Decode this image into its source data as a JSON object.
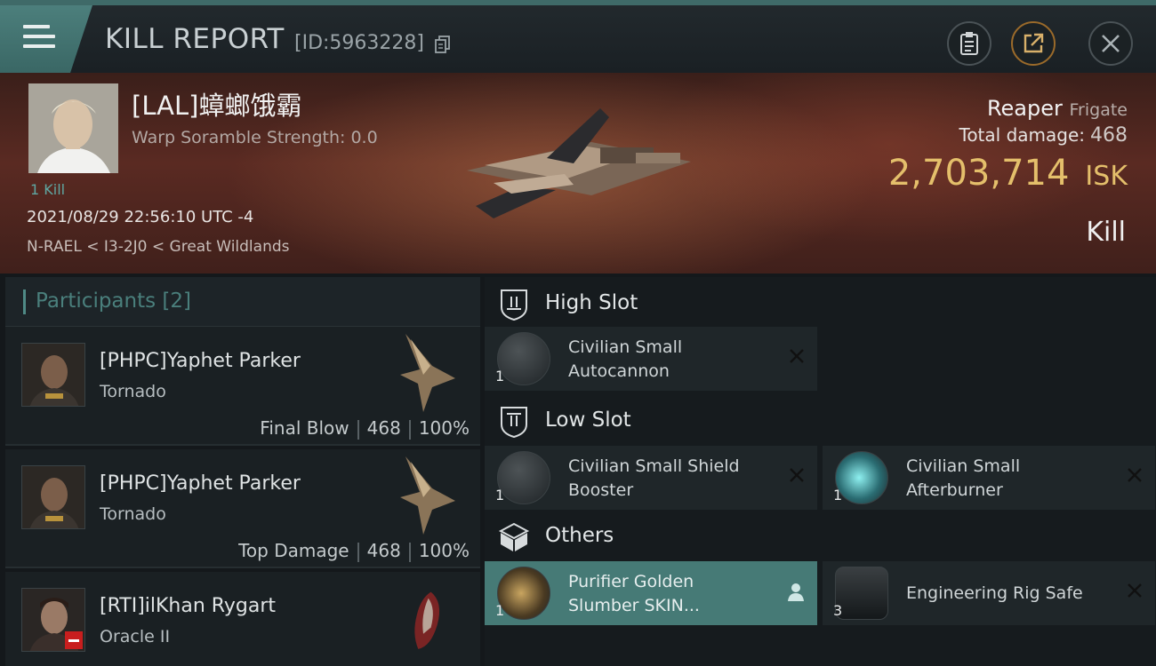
{
  "header": {
    "title": "KILL REPORT",
    "report_id": "[ID:5963228]",
    "icons": [
      "menu-icon",
      "copy-icon",
      "clipboard-icon",
      "share-icon",
      "close-icon"
    ]
  },
  "victim": {
    "name": "[LAL]蟑螂饿霸",
    "warp_scramble": "Warp Soramble Strength: 0.0",
    "kills_label": "1 Kill",
    "datetime": "2021/08/29 22:56:10 UTC -4",
    "location": "N-RAEL < I3-2J0 < Great Wildlands",
    "ship_name": "Reaper",
    "ship_class": "Frigate",
    "total_damage_label": "Total damage:",
    "total_damage": "468",
    "isk_value": "2,703,714",
    "isk_unit": "ISK",
    "result": "Kill"
  },
  "participants": {
    "label": "Participants",
    "count": "[2]",
    "rows": [
      {
        "name": "[PHPC]Yaphet Parker",
        "ship": "Tornado",
        "role": "Final Blow",
        "damage": "468",
        "percent": "100%"
      },
      {
        "name": "[PHPC]Yaphet Parker",
        "ship": "Tornado",
        "role": "Top Damage",
        "damage": "468",
        "percent": "100%"
      },
      {
        "name": "[RTI]ilKhan Rygart",
        "ship": "Oracle II",
        "role": "",
        "damage": "",
        "percent": ""
      }
    ]
  },
  "slots": {
    "high": {
      "label": "High Slot",
      "items": [
        {
          "name_line1": "Civilian Small",
          "name_line2": "Autocannon",
          "qty": "1"
        }
      ]
    },
    "low": {
      "label": "Low Slot",
      "items": [
        {
          "name_line1": "Civilian Small Shield",
          "name_line2": "Booster",
          "qty": "1"
        },
        {
          "name_line1": "Civilian Small",
          "name_line2": "Afterburner",
          "qty": "1"
        }
      ]
    },
    "others": {
      "label": "Others",
      "items": [
        {
          "name_line1": "Purifier Golden",
          "name_line2": "Slumber SKIN...",
          "qty": "1"
        },
        {
          "name_line1": "Engineering Rig Safe",
          "name_line2": "",
          "qty": "3"
        }
      ]
    }
  },
  "colors": {
    "accent_teal": "#467a76",
    "isk_gold": "#e4bf6b",
    "banner_red": "#5a2a22"
  }
}
